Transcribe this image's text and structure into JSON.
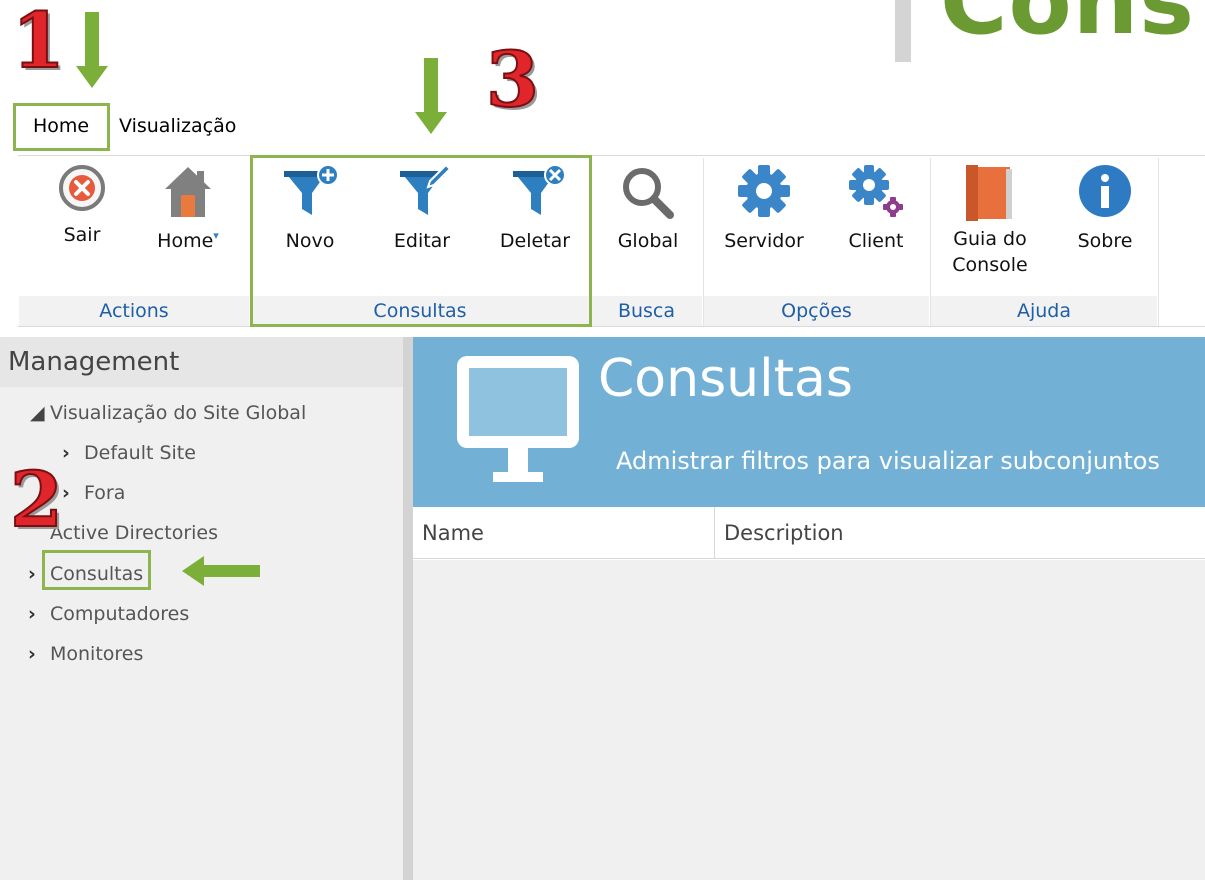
{
  "header": {
    "title_fragment": "Cons"
  },
  "annotations": {
    "step1": "1",
    "step2": "2",
    "step3": "3"
  },
  "menu": {
    "tabs": [
      "Home",
      "Visualização"
    ]
  },
  "ribbon": {
    "buttons": {
      "sair": "Sair",
      "home": "Home",
      "novo": "Novo",
      "editar": "Editar",
      "deletar": "Deletar",
      "global": "Global",
      "servidor": "Servidor",
      "client": "Client",
      "guia_line1": "Guia do",
      "guia_line2": "Console",
      "sobre": "Sobre"
    },
    "groups": [
      "Actions",
      "Consultas",
      "Busca",
      "Opções",
      "Ajuda"
    ]
  },
  "sidebar": {
    "title": "Management",
    "items": [
      "Visualização do Site Global",
      "Default Site",
      "Fora",
      "Active Directories",
      "Consultas",
      "Computadores",
      "Monitores"
    ]
  },
  "main": {
    "banner_title": "Consultas",
    "banner_subtitle": "Admistrar filtros para visualizar subconjuntos",
    "columns": [
      "Name",
      "Description"
    ]
  },
  "colors": {
    "accent_green": "#7caf3a",
    "banner_blue": "#72b0d5",
    "group_label_blue": "#1f5fa8",
    "step_red": "#e0262b"
  }
}
